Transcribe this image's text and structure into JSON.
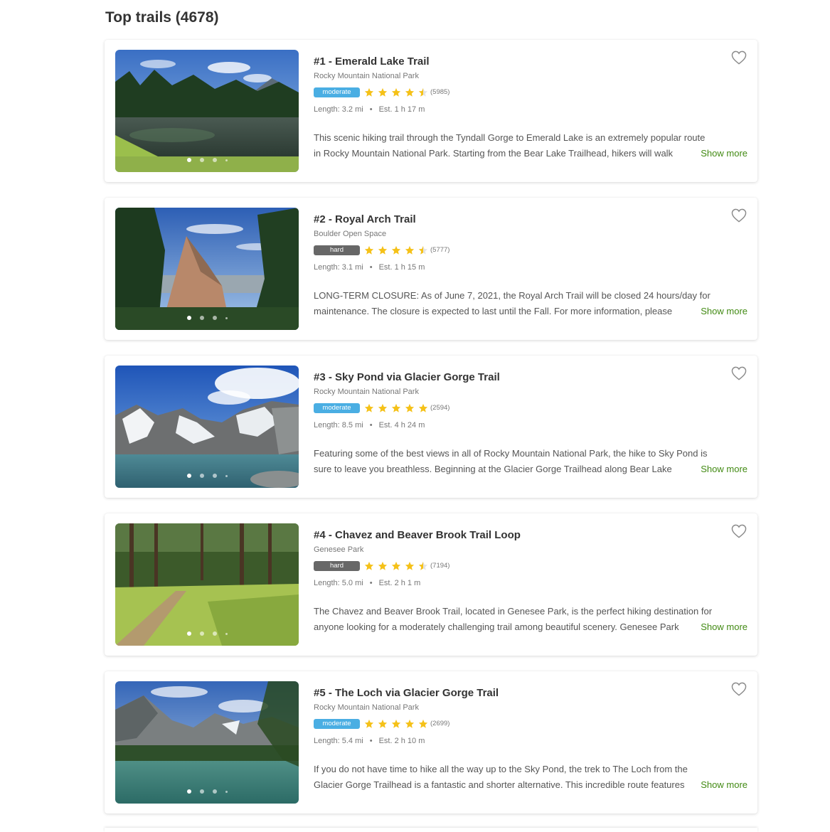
{
  "page": {
    "title": "Top trails (4678)"
  },
  "ui": {
    "show_more_label": "Show more",
    "accent_color": "#428a13",
    "star_color": "#f5c118",
    "moderate_color": "#4aaee3",
    "hard_color": "#676767"
  },
  "trails": [
    {
      "title": "#1 - Emerald Lake Trail",
      "park": "Rocky Mountain National Park",
      "difficulty": "moderate",
      "rating": 4.5,
      "reviews": "(5985)",
      "length": "Length: 3.2 mi",
      "est": "Est. 1 h 17 m",
      "desc_line1": "This scenic hiking trail through the Tyndall Gorge to Emerald Lake is an extremely popular route",
      "desc_line2": "in Rocky Mountain National Park. Starting from the Bear Lake Trailhead, hikers will walk",
      "image_icon": "lake-forest-photo"
    },
    {
      "title": "#2 - Royal Arch Trail",
      "park": "Boulder Open Space",
      "difficulty": "hard",
      "rating": 4.5,
      "reviews": "(5777)",
      "length": "Length: 3.1 mi",
      "est": "Est. 1 h 15 m",
      "desc_line1": "LONG-TERM CLOSURE: As of June 7, 2021, the Royal Arch Trail will be closed 24 hours/day for",
      "desc_line2": "maintenance. The closure is expected to last until the Fall. For more information, please",
      "image_icon": "rock-flatirons-photo"
    },
    {
      "title": "#3 - Sky Pond via Glacier Gorge Trail",
      "park": "Rocky Mountain National Park",
      "difficulty": "moderate",
      "rating": 5,
      "reviews": "(2594)",
      "length": "Length: 8.5 mi",
      "est": "Est. 4 h 24 m",
      "desc_line1": "Featuring some of the best views in all of Rocky Mountain National Park, the hike to Sky Pond is",
      "desc_line2": "sure to leave you breathless. Beginning at the Glacier Gorge Trailhead along Bear Lake",
      "image_icon": "alpine-lake-photo"
    },
    {
      "title": "#4 - Chavez and Beaver Brook Trail Loop",
      "park": "Genesee Park",
      "difficulty": "hard",
      "rating": 4.5,
      "reviews": "(7194)",
      "length": "Length: 5.0 mi",
      "est": "Est. 2 h 1 m",
      "desc_line1": "The Chavez and Beaver Brook Trail, located in Genesee Park, is the perfect hiking destination for",
      "desc_line2": "anyone looking for a moderately challenging trail among beautiful scenery. Genesee Park",
      "image_icon": "forest-path-photo"
    },
    {
      "title": "#5 - The Loch via Glacier Gorge Trail",
      "park": "Rocky Mountain National Park",
      "difficulty": "moderate",
      "rating": 5,
      "reviews": "(2699)",
      "length": "Length: 5.4 mi",
      "est": "Est. 2 h 10 m",
      "desc_line1": "If you do not have time to hike all the way up to the Sky Pond, the trek to The Loch from the",
      "desc_line2": "Glacier Gorge Trailhead is a fantastic and shorter alternative. This incredible route features",
      "image_icon": "mountain-lake-photo"
    }
  ]
}
